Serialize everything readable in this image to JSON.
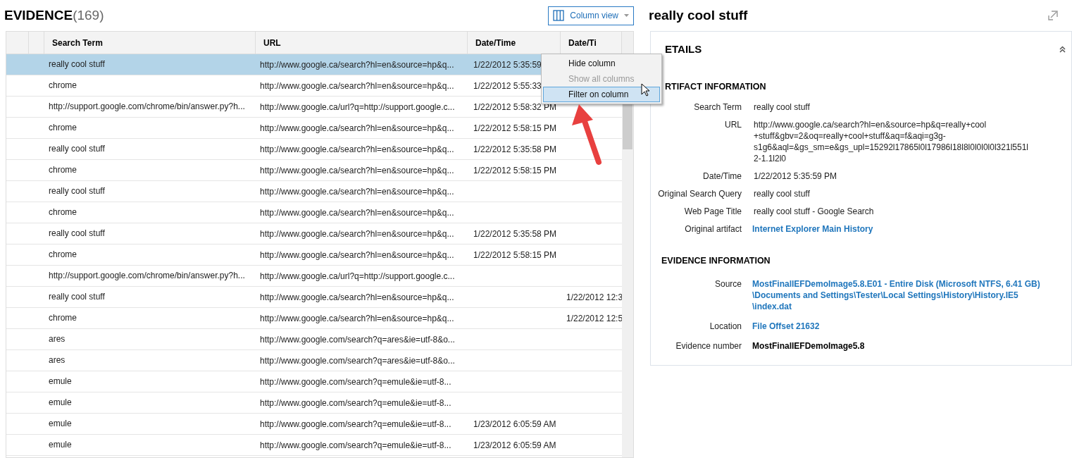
{
  "evidence": {
    "title": "EVIDENCE",
    "count": "(169)"
  },
  "column_view_button": {
    "label": "Column view"
  },
  "table": {
    "columns": [
      "",
      "",
      "Search Term",
      "URL",
      "Date/Time",
      "Date/Ti"
    ],
    "rows": [
      {
        "search_term": "really cool stuff",
        "url": "http://www.google.ca/search?hl=en&source=hp&q...",
        "date_time": "1/22/2012 5:35:59",
        "column_4": "",
        "selected": true
      },
      {
        "search_term": "chrome",
        "url": "http://www.google.ca/search?hl=en&source=hp&q...",
        "date_time": "1/22/2012 5:55:33",
        "column_4": "",
        "selected": false
      },
      {
        "search_term": "http://support.google.com/chrome/bin/answer.py?h...",
        "url": "http://www.google.ca/url?q=http://support.google.c...",
        "date_time": "1/22/2012 5:58:32 PM",
        "column_4": "",
        "selected": false
      },
      {
        "search_term": "chrome",
        "url": "http://www.google.ca/search?hl=en&source=hp&q...",
        "date_time": "1/22/2012 5:58:15 PM",
        "column_4": "",
        "selected": false
      },
      {
        "search_term": "really cool stuff",
        "url": "http://www.google.ca/search?hl=en&source=hp&q...",
        "date_time": "1/22/2012 5:35:58 PM",
        "column_4": "",
        "selected": false
      },
      {
        "search_term": "chrome",
        "url": "http://www.google.ca/search?hl=en&source=hp&q...",
        "date_time": "1/22/2012 5:58:15 PM",
        "column_4": "",
        "selected": false
      },
      {
        "search_term": "really cool stuff",
        "url": "http://www.google.ca/search?hl=en&source=hp&q...",
        "date_time": "",
        "column_4": "",
        "selected": false
      },
      {
        "search_term": "chrome",
        "url": "http://www.google.ca/search?hl=en&source=hp&q...",
        "date_time": "",
        "column_4": "",
        "selected": false
      },
      {
        "search_term": "really cool stuff",
        "url": "http://www.google.ca/search?hl=en&source=hp&q...",
        "date_time": "1/22/2012 5:35:58 PM",
        "column_4": "",
        "selected": false
      },
      {
        "search_term": "chrome",
        "url": "http://www.google.ca/search?hl=en&source=hp&q...",
        "date_time": "1/22/2012 5:58:15 PM",
        "column_4": "",
        "selected": false
      },
      {
        "search_term": "http://support.google.com/chrome/bin/answer.py?h...",
        "url": "http://www.google.ca/url?q=http://support.google.c...",
        "date_time": "",
        "column_4": "",
        "selected": false
      },
      {
        "search_term": "really cool stuff",
        "url": "http://www.google.ca/search?hl=en&source=hp&q...",
        "date_time": "",
        "column_4": "1/22/2012 12:3",
        "selected": false
      },
      {
        "search_term": "chrome",
        "url": "http://www.google.ca/search?hl=en&source=hp&q...",
        "date_time": "",
        "column_4": "1/22/2012 12:5",
        "selected": false
      },
      {
        "search_term": "ares",
        "url": "http://www.google.com/search?q=ares&ie=utf-8&o...",
        "date_time": "",
        "column_4": "",
        "selected": false
      },
      {
        "search_term": "ares",
        "url": "http://www.google.com/search?q=ares&ie=utf-8&o...",
        "date_time": "",
        "column_4": "",
        "selected": false
      },
      {
        "search_term": "emule",
        "url": "http://www.google.com/search?q=emule&ie=utf-8...",
        "date_time": "",
        "column_4": "",
        "selected": false
      },
      {
        "search_term": "emule",
        "url": "http://www.google.com/search?q=emule&ie=utf-8...",
        "date_time": "",
        "column_4": "",
        "selected": false
      },
      {
        "search_term": "emule",
        "url": "http://www.google.com/search?q=emule&ie=utf-8...",
        "date_time": "1/23/2012 6:05:59 AM",
        "column_4": "",
        "selected": false
      },
      {
        "search_term": "emule",
        "url": "http://www.google.com/search?q=emule&ie=utf-8...",
        "date_time": "1/23/2012 6:05:59 AM",
        "column_4": "",
        "selected": false
      }
    ]
  },
  "context_menu": {
    "items": [
      {
        "label": "Hide column",
        "disabled": false,
        "selected": false
      },
      {
        "label": "Show all columns",
        "disabled": true,
        "selected": false
      },
      {
        "label": "Filter on column",
        "disabled": false,
        "selected": true
      }
    ]
  },
  "details": {
    "title": "really cool stuff",
    "section_title": "ETAILS",
    "artifact_heading": "RTIFACT INFORMATION",
    "artifact_fields": [
      {
        "label": "Search Term",
        "value": "really cool stuff",
        "kind": "text"
      },
      {
        "label": "URL",
        "value": "http://www.google.ca/search?hl=en&source=hp&q=really+cool +stuff&gbv=2&oq=really+cool+stuff&aq=f&aqi=g3g- s1g6&aql=&gs_sm=e&gs_upl=15292l17865l0l17986l18l8l0l0l0l0l321l551l 2-1.1l2l0",
        "kind": "text"
      },
      {
        "label": "Date/Time",
        "value": "1/22/2012 5:35:59 PM",
        "kind": "text"
      },
      {
        "label": "Original Search Query",
        "value": "really cool stuff",
        "kind": "text"
      },
      {
        "label": "Web Page Title",
        "value": "really cool stuff - Google Search",
        "kind": "text"
      },
      {
        "label": "Original artifact",
        "value": "Internet Explorer Main History",
        "kind": "link"
      }
    ],
    "evidence_heading": "EVIDENCE INFORMATION",
    "evidence_fields": [
      {
        "label": "Source",
        "value": "MostFinalIEFDemoImage5.8.E01 - Entire Disk (Microsoft NTFS, 6.41 GB) \\Documents and Settings\\Tester\\Local Settings\\History\\History.IE5 \\index.dat",
        "kind": "link"
      },
      {
        "label": "Location",
        "value": "File Offset 21632",
        "kind": "link"
      },
      {
        "label": "Evidence number",
        "value": "MostFinalIEFDemoImage5.8",
        "kind": "bold"
      }
    ]
  }
}
